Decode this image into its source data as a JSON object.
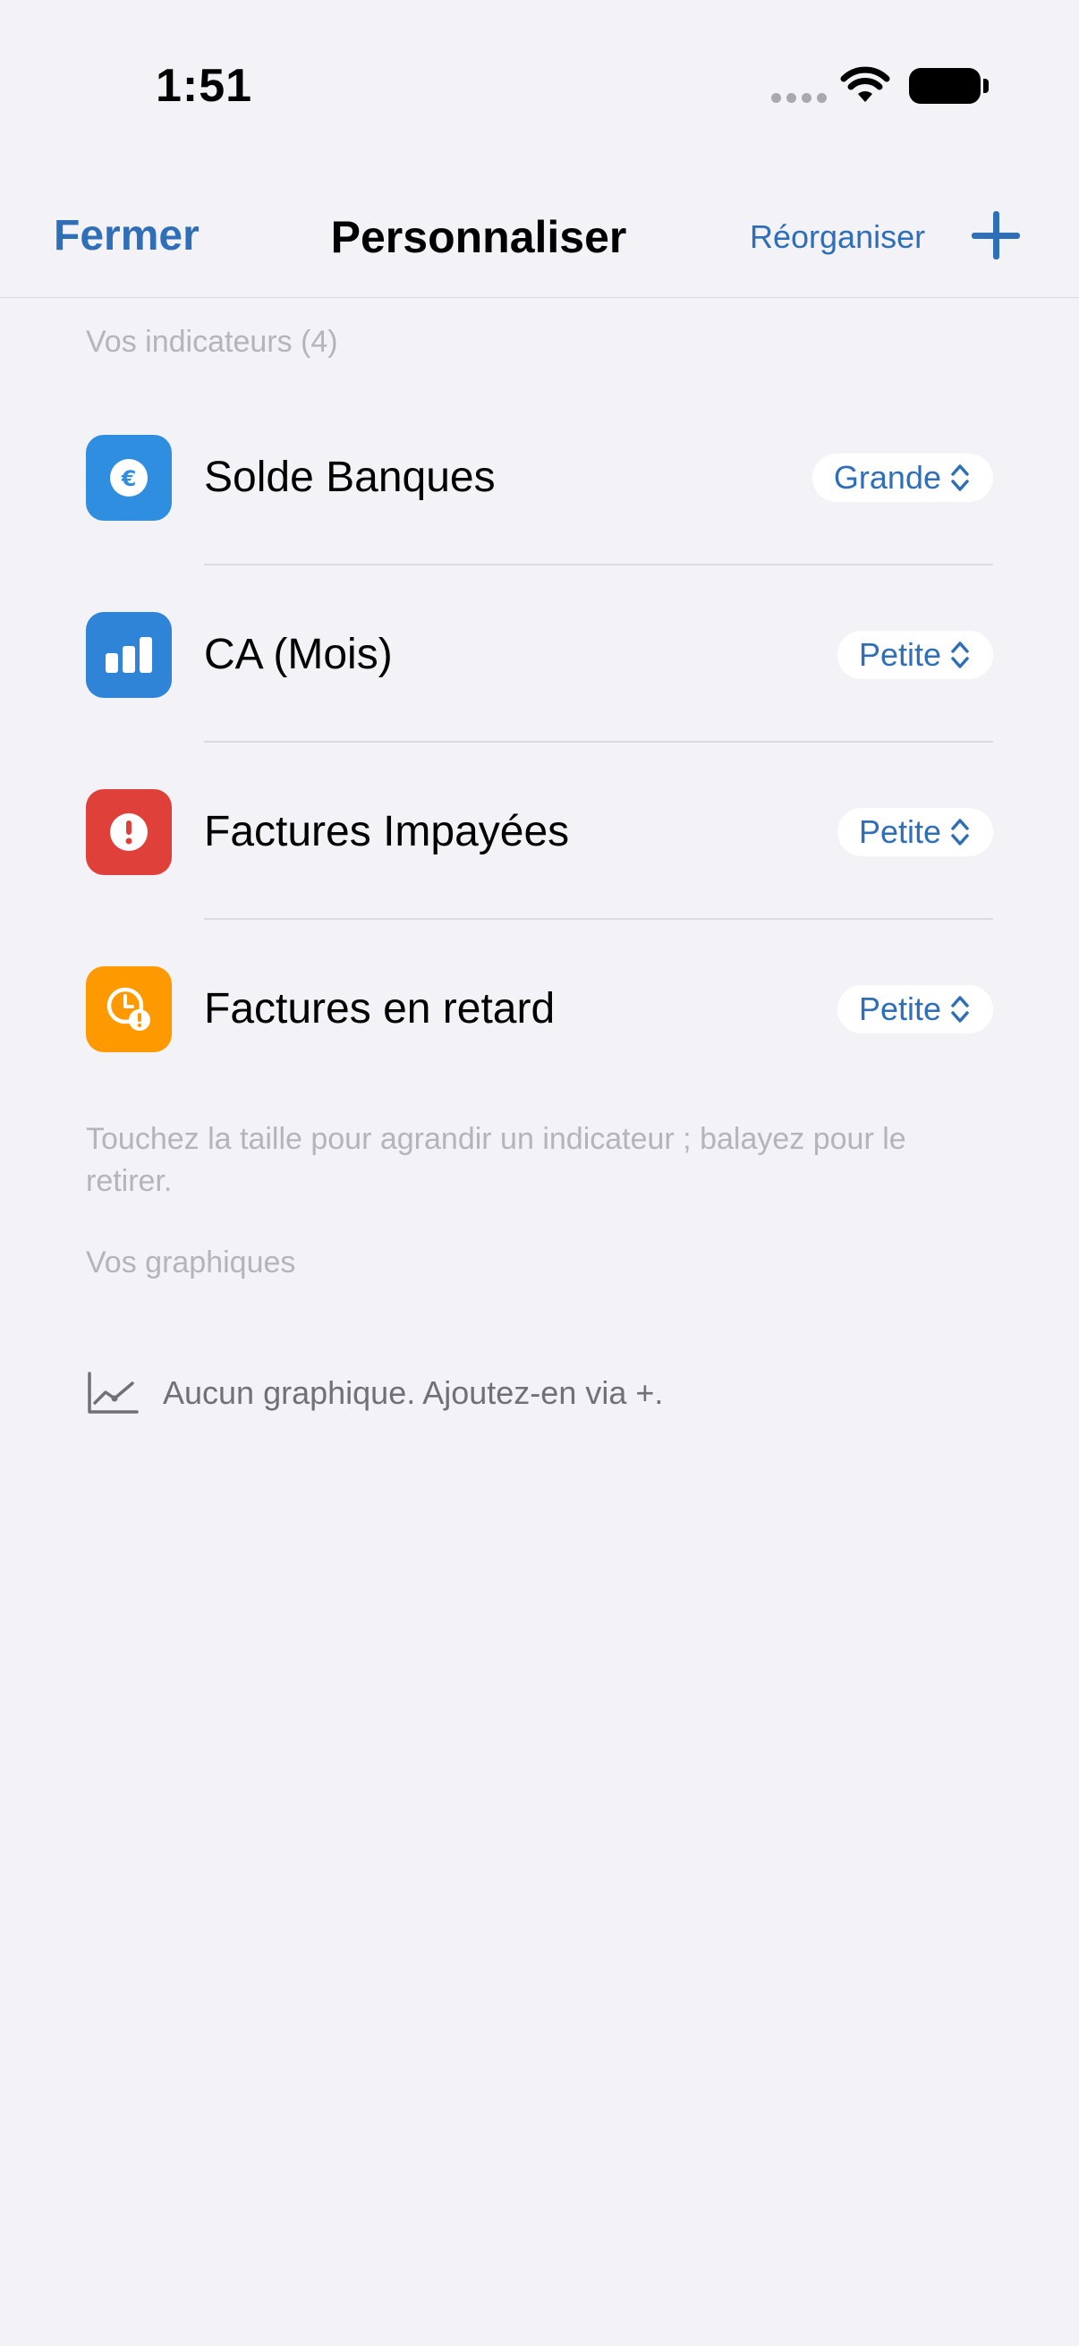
{
  "status_bar": {
    "time": "1:51"
  },
  "nav": {
    "close_label": "Fermer",
    "title": "Personnaliser",
    "reorder_label": "Réorganiser",
    "add_label": "+"
  },
  "indicators": {
    "header": "Vos indicateurs (4)",
    "items": [
      {
        "label": "Solde Banques",
        "size": "Grande",
        "icon": "euro-icon",
        "color": "#2f8ee0"
      },
      {
        "label": "CA (Mois)",
        "size": "Petite",
        "icon": "bar-chart-icon",
        "color": "#2f84d8"
      },
      {
        "label": "Factures Impayées",
        "size": "Petite",
        "icon": "exclamation-icon",
        "color": "#e0403a"
      },
      {
        "label": "Factures en retard",
        "size": "Petite",
        "icon": "clock-alert-icon",
        "color": "#ff9900"
      }
    ],
    "hint": "Touchez la taille pour agrandir un indicateur ; balayez pour le retirer."
  },
  "charts": {
    "header": "Vos graphiques",
    "empty_text": "Aucun graphique. Ajoutez-en via +.",
    "empty_icon": "line-chart-icon"
  },
  "colors": {
    "accent": "#2f6fb8",
    "background": "#f2f2f7"
  }
}
